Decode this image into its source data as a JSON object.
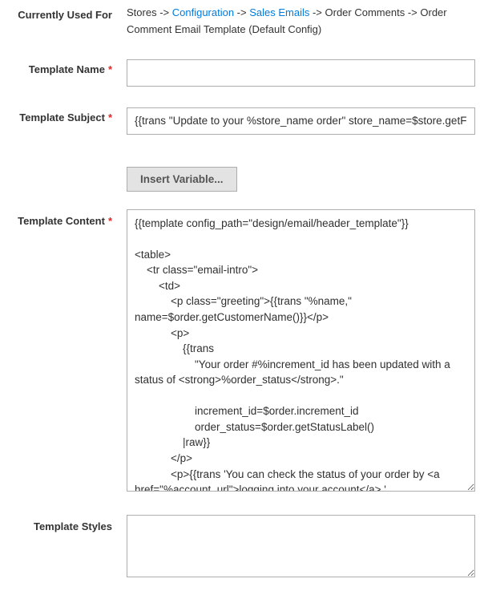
{
  "currently_used_for": {
    "label": "Currently Used For",
    "path_parts": [
      {
        "text": "Stores",
        "link": false
      },
      {
        "text": "Configuration",
        "link": true
      },
      {
        "text": "Sales Emails",
        "link": true
      },
      {
        "text": "Order Comments",
        "link": false
      },
      {
        "text": "Order Comment Email Template  (Default Config)",
        "link": false
      }
    ]
  },
  "template_name": {
    "label": "Template Name",
    "value": "",
    "required_mark": "*"
  },
  "template_subject": {
    "label": "Template Subject",
    "value": "{{trans \"Update to your %store_name order\" store_name=$store.getFrontendName()}}",
    "required_mark": "*"
  },
  "insert_variable": {
    "label": "Insert Variable..."
  },
  "template_content": {
    "label": "Template Content",
    "required_mark": "*",
    "value": "{{template config_path=\"design/email/header_template\"}}\n\n<table>\n    <tr class=\"email-intro\">\n        <td>\n            <p class=\"greeting\">{{trans \"%name,\" name=$order.getCustomerName()}}</p>\n            <p>\n                {{trans\n                    \"Your order #%increment_id has been updated with a status of <strong>%order_status</strong>.\"\n\n                    increment_id=$order.increment_id\n                    order_status=$order.getStatusLabel()\n                |raw}}\n            </p>\n            <p>{{trans 'You can check the status of your order by <a href=\"%account_url\">logging into your account</a>.' account_url=$this.getUrl($store,'customer/account/',[_nosid:1]) |raw}}</p>\n            <p>\n"
  },
  "template_styles": {
    "label": "Template Styles",
    "value": ""
  }
}
